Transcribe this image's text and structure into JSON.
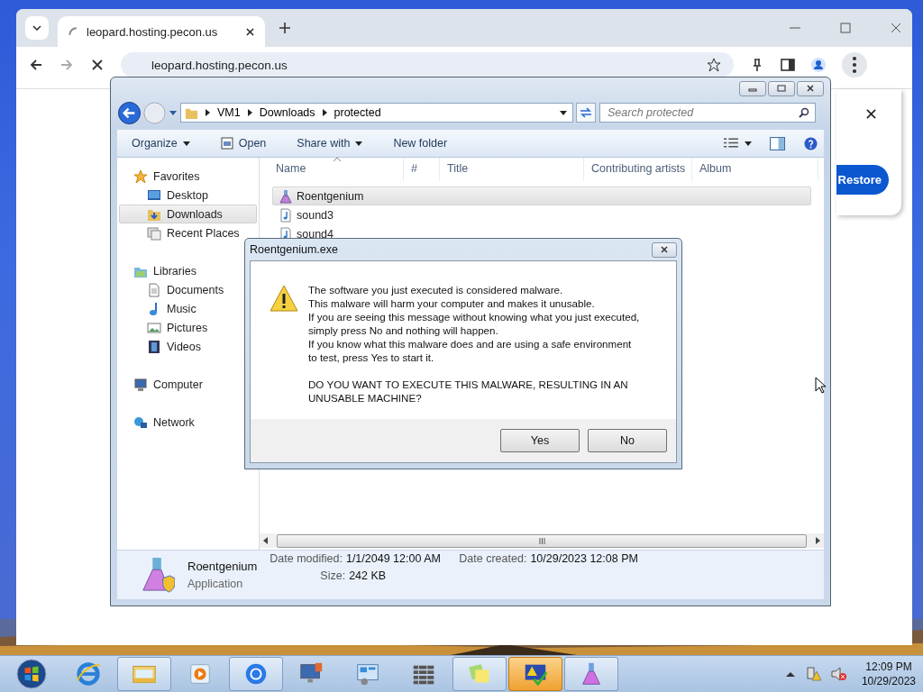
{
  "browser": {
    "tab_title": "leopard.hosting.pecon.us",
    "url": "leopard.hosting.pecon.us",
    "popup_button": "Restore"
  },
  "explorer": {
    "breadcrumb": [
      "VM1",
      "Downloads",
      "protected"
    ],
    "search_placeholder": "Search protected",
    "toolbar": [
      {
        "label": "Organize",
        "has_menu": true,
        "kind": "plain"
      },
      {
        "label": "Open",
        "has_menu": false,
        "kind": "open"
      },
      {
        "label": "Share with",
        "has_menu": true,
        "kind": "plain"
      },
      {
        "label": "New folder",
        "has_menu": false,
        "kind": "plain"
      }
    ],
    "nav": [
      {
        "label": "Favorites",
        "kind": "star",
        "children": [
          {
            "label": "Desktop",
            "kind": "desktop",
            "selected": false
          },
          {
            "label": "Downloads",
            "kind": "downloads",
            "selected": true
          },
          {
            "label": "Recent Places",
            "kind": "recent",
            "selected": false
          }
        ]
      },
      {
        "label": "Libraries",
        "kind": "libraries",
        "children": [
          {
            "label": "Documents",
            "kind": "documents",
            "selected": false
          },
          {
            "label": "Music",
            "kind": "music",
            "selected": false
          },
          {
            "label": "Pictures",
            "kind": "pictures",
            "selected": false
          },
          {
            "label": "Videos",
            "kind": "videos",
            "selected": false
          }
        ]
      },
      {
        "label": "Computer",
        "kind": "computer"
      },
      {
        "label": "Network",
        "kind": "network"
      }
    ],
    "columns": [
      "Name",
      "#",
      "Title",
      "Contributing artists",
      "Album"
    ],
    "files": [
      {
        "name": "Roentgenium",
        "kind": "application",
        "selected": true
      },
      {
        "name": "sound3",
        "kind": "audio",
        "selected": false
      },
      {
        "name": "sound4",
        "kind": "audio",
        "selected": false
      }
    ],
    "details": {
      "name": "Roentgenium",
      "type": "Application",
      "fields": [
        {
          "label": "Date modified:",
          "value": "1/1/2049 12:00 AM"
        },
        {
          "label": "Date created:",
          "value": "10/29/2023 12:08 PM"
        },
        {
          "label": "Size:",
          "value": "242 KB"
        }
      ]
    }
  },
  "dialog": {
    "title": "Roentgenium.exe",
    "paragraphs": [
      "The software you just executed is considered malware.\nThis malware will harm your computer and makes it unusable.\nIf you are seeing this message without knowing what you just executed,\nsimply press No and nothing will happen.\nIf you know what this malware does and are using a safe environment\nto test, press Yes to start it.",
      "DO YOU WANT TO EXECUTE THIS MALWARE, RESULTING IN AN\nUNUSABLE MACHINE?"
    ],
    "buttons": [
      "Yes",
      "No"
    ]
  },
  "taskbar": {
    "items": [
      {
        "kind": "ie",
        "open": false,
        "alert": false
      },
      {
        "kind": "explorer",
        "open": true,
        "alert": false
      },
      {
        "kind": "media",
        "open": false,
        "alert": false
      },
      {
        "kind": "chrome",
        "open": true,
        "alert": false
      },
      {
        "kind": "remote",
        "open": false,
        "alert": false
      },
      {
        "kind": "panel",
        "open": false,
        "alert": false
      },
      {
        "kind": "wall",
        "open": false,
        "alert": false
      },
      {
        "kind": "notes",
        "open": true,
        "alert": false
      },
      {
        "kind": "warning",
        "open": true,
        "alert": true
      },
      {
        "kind": "flask",
        "open": true,
        "alert": false
      }
    ],
    "time": "12:09 PM",
    "date": "10/29/2023"
  }
}
